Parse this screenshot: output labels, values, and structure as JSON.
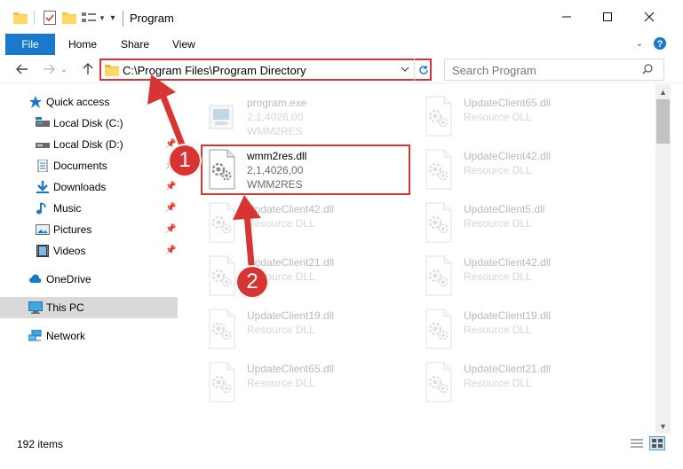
{
  "window": {
    "title": "Program",
    "controls": {
      "minimize_icon": "minimize-icon",
      "maximize_icon": "maximize-icon",
      "close_icon": "close-icon"
    }
  },
  "ribbon": {
    "tabs": [
      {
        "label": "File",
        "active": true
      },
      {
        "label": "Home"
      },
      {
        "label": "Share"
      },
      {
        "label": "View"
      }
    ]
  },
  "address": {
    "path": "C:\\Program Files\\Program Directory"
  },
  "search": {
    "placeholder": "Search Program"
  },
  "nav": {
    "items": [
      {
        "label": "Quick access",
        "icon": "star-icon",
        "pinned": false
      },
      {
        "label": "Local Disk (C:)",
        "icon": "drive-icon",
        "pinned": false
      },
      {
        "label": "Local Disk (D:)",
        "icon": "drive-icon",
        "pinned": true
      },
      {
        "label": "Documents",
        "icon": "documents-icon",
        "pinned": true
      },
      {
        "label": "Downloads",
        "icon": "download-icon",
        "pinned": true
      },
      {
        "label": "Music",
        "icon": "music-icon",
        "pinned": true
      },
      {
        "label": "Pictures",
        "icon": "pictures-icon",
        "pinned": true
      },
      {
        "label": "Videos",
        "icon": "videos-icon",
        "pinned": true
      },
      {
        "label": "OneDrive",
        "icon": "cloud-icon",
        "pinned": false
      },
      {
        "label": "This PC",
        "icon": "computer-icon",
        "pinned": false,
        "selected": true
      },
      {
        "label": "Network",
        "icon": "network-icon",
        "pinned": false
      }
    ]
  },
  "files": [
    {
      "name": "program.exe",
      "line1": "2,1,4026,00",
      "line2": "WMM2RES",
      "faded": true
    },
    {
      "name": "UpdateClient65.dll",
      "line1": "Resource DLL",
      "faded": true
    },
    {
      "name": "wmm2res.dll",
      "line1": "2,1,4026,00",
      "line2": "WMM2RES",
      "faded": false,
      "highlighted": true
    },
    {
      "name": "UpdateClient42.dll",
      "line1": "Resource DLL",
      "faded": true
    },
    {
      "name": "UpdateClient42.dll",
      "line1": "Resource DLL",
      "faded": true
    },
    {
      "name": "UpdateClient5.dll",
      "line1": "Resource DLL",
      "faded": true
    },
    {
      "name": "UpdateClient21.dll",
      "line1": "Resource DLL",
      "faded": true
    },
    {
      "name": "UpdateClient42.dll",
      "line1": "Resource DLL",
      "faded": true
    },
    {
      "name": "UpdateClient19.dll",
      "line1": "Resource DLL",
      "faded": true
    },
    {
      "name": "UpdateClient19.dll",
      "line1": "Resource DLL",
      "faded": true
    },
    {
      "name": "UpdateClient65.dll",
      "line1": "Resource DLL",
      "faded": true
    },
    {
      "name": "UpdateClient21.dll",
      "line1": "Resource DLL",
      "faded": true
    }
  ],
  "status": {
    "item_count": "192 items"
  },
  "annotations": {
    "step1": "1",
    "step2": "2",
    "accent": "#d93434"
  },
  "colors": {
    "file_tab": "#1979ca",
    "selection": "#d9d9d9"
  }
}
